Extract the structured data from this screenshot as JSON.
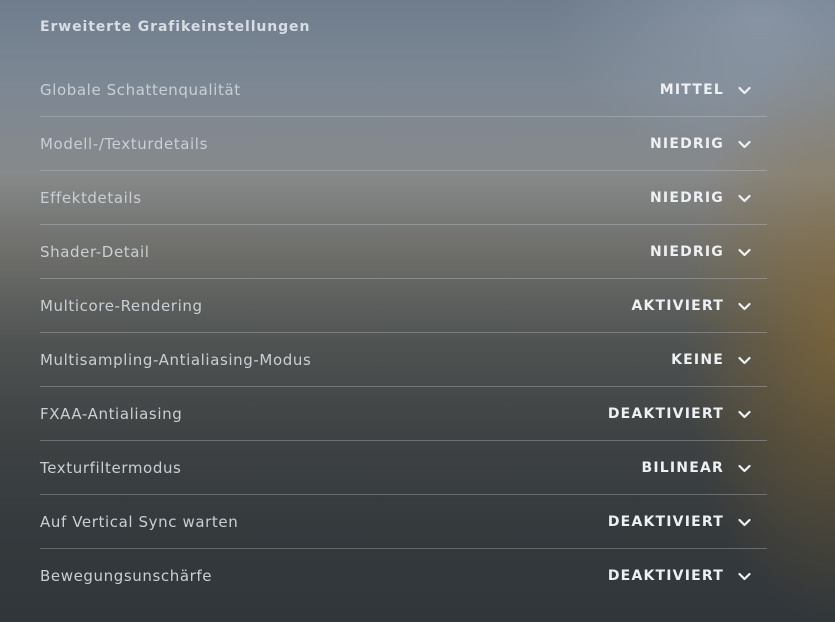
{
  "section": {
    "title": "Erweiterte Grafikeinstellungen"
  },
  "settings": [
    {
      "label": "Globale Schattenqualität",
      "value": "MITTEL",
      "icon": "chevron-down-icon"
    },
    {
      "label": "Modell-/Texturdetails",
      "value": "NIEDRIG",
      "icon": "chevron-down-icon"
    },
    {
      "label": "Effektdetails",
      "value": "NIEDRIG",
      "icon": "chevron-down-icon"
    },
    {
      "label": "Shader-Detail",
      "value": "NIEDRIG",
      "icon": "chevron-down-icon"
    },
    {
      "label": "Multicore-Rendering",
      "value": "AKTIVIERT",
      "icon": "chevron-down-icon"
    },
    {
      "label": "Multisampling-Antialiasing-Modus",
      "value": "KEINE",
      "icon": "chevron-down-icon"
    },
    {
      "label": "FXAA-Antialiasing",
      "value": "DEAKTIVIERT",
      "icon": "chevron-down-icon"
    },
    {
      "label": "Texturfiltermodus",
      "value": "BILINEAR",
      "icon": "chevron-down-icon"
    },
    {
      "label": "Auf Vertical Sync warten",
      "value": "DEAKTIVIERT",
      "icon": "chevron-down-icon"
    },
    {
      "label": "Bewegungsunschärfe",
      "value": "DEAKTIVIERT",
      "icon": "chevron-down-icon"
    }
  ],
  "colors": {
    "label_text": "#c9cfd5",
    "value_text": "#eef1f4",
    "divider": "#cdd4dc"
  }
}
